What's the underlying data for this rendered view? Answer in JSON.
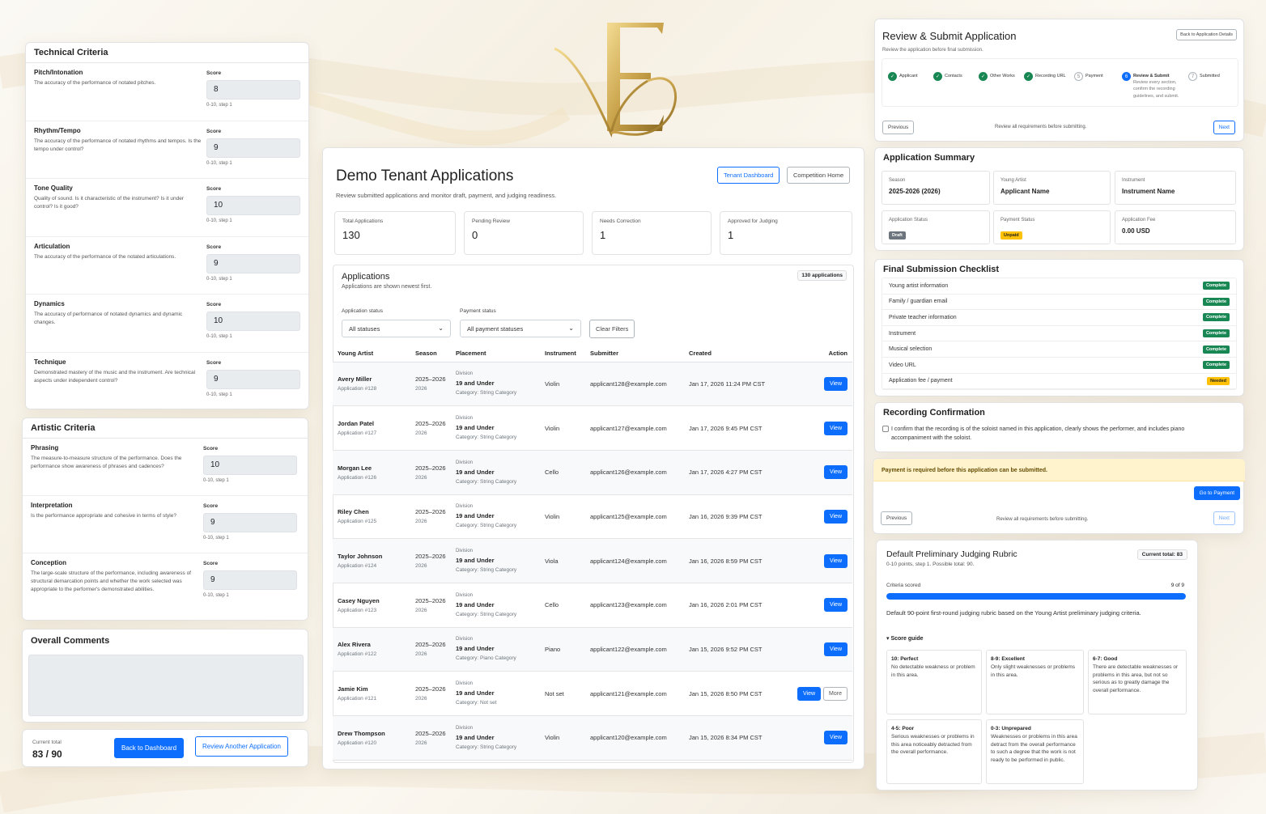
{
  "rubric": {
    "technical_title": "Technical Criteria",
    "artistic_title": "Artistic Criteria",
    "technical": [
      {
        "name": "Pitch/Intonation",
        "desc": "The accuracy of the performance of notated pitches.",
        "score_label": "Score",
        "score": "8",
        "hint": "0-10, step 1"
      },
      {
        "name": "Rhythm/Tempo",
        "desc": "The accuracy of the performance of notated rhythms and tempos. Is the tempo under control?",
        "score_label": "Score",
        "score": "9",
        "hint": "0-10, step 1"
      },
      {
        "name": "Tone Quality",
        "desc": "Quality of sound. Is it characteristic of the instrument? Is it under control? Is it good?",
        "score_label": "Score",
        "score": "10",
        "hint": "0-10, step 1"
      },
      {
        "name": "Articulation",
        "desc": "The accuracy of the performance of the notated articulations.",
        "score_label": "Score",
        "score": "9",
        "hint": "0-10, step 1"
      },
      {
        "name": "Dynamics",
        "desc": "The accuracy of performance of notated dynamics and dynamic changes.",
        "score_label": "Score",
        "score": "10",
        "hint": "0-10, step 1"
      },
      {
        "name": "Technique",
        "desc": "Demonstrated mastery of the music and the instrument. Are technical aspects under independent control?",
        "score_label": "Score",
        "score": "9",
        "hint": "0-10, step 1"
      }
    ],
    "artistic": [
      {
        "name": "Phrasing",
        "desc": "The measure-to-measure structure of the performance. Does the performance show awareness of phrases and cadences?",
        "score_label": "Score",
        "score": "10",
        "hint": "0-10, step 1"
      },
      {
        "name": "Interpretation",
        "desc": "Is the performance appropriate and cohesive in terms of style?",
        "score_label": "Score",
        "score": "9",
        "hint": "0-10, step 1"
      },
      {
        "name": "Conception",
        "desc": "The large-scale structure of the performance, including awareness of structural demarcation points and whether the work selected was appropriate to the performer's demonstrated abilities.",
        "score_label": "Score",
        "score": "9",
        "hint": "0-10, step 1"
      }
    ],
    "comments_title": "Overall Comments",
    "total_label": "Current total",
    "total_value": "83 / 90",
    "back_button": "Back to Dashboard",
    "review_another_button": "Review Another Application"
  },
  "center": {
    "title": "Demo Tenant Applications",
    "subtitle": "Review submitted applications and monitor draft, payment, and judging readiness.",
    "tenant_dashboard_button": "Tenant Dashboard",
    "competition_home_button": "Competition Home",
    "stats": [
      {
        "label": "Total Applications",
        "value": "130"
      },
      {
        "label": "Pending Review",
        "value": "0"
      },
      {
        "label": "Needs Correction",
        "value": "1"
      },
      {
        "label": "Approved for Judging",
        "value": "1"
      }
    ],
    "apps_title": "Applications",
    "apps_subtitle": "Applications are shown newest first.",
    "apps_count": "130 applications",
    "filter_status_label": "Application status",
    "filter_status_value": "All statuses",
    "filter_payment_label": "Payment status",
    "filter_payment_value": "All payment statuses",
    "clear_filters": "Clear Filters",
    "columns": [
      "Young Artist",
      "Season",
      "Placement",
      "Instrument",
      "Submitter",
      "Created",
      "Action"
    ],
    "rows": [
      {
        "name": "Avery Miller",
        "app": "Application #128",
        "season1": "2025–2026",
        "season2": "2026",
        "division_label": "Division",
        "division": "19 and Under",
        "category": "Category: String Category",
        "instrument": "Violin",
        "submitter": "applicant128@example.com",
        "created": "Jan 17, 2026 11:24 PM CST",
        "view": "View",
        "more": ""
      },
      {
        "name": "Jordan Patel",
        "app": "Application #127",
        "season1": "2025–2026",
        "season2": "2026",
        "division_label": "Division",
        "division": "19 and Under",
        "category": "Category: String Category",
        "instrument": "Violin",
        "submitter": "applicant127@example.com",
        "created": "Jan 17, 2026 9:45 PM CST",
        "view": "View",
        "more": ""
      },
      {
        "name": "Morgan Lee",
        "app": "Application #126",
        "season1": "2025–2026",
        "season2": "2026",
        "division_label": "Division",
        "division": "19 and Under",
        "category": "Category: String Category",
        "instrument": "Cello",
        "submitter": "applicant126@example.com",
        "created": "Jan 17, 2026 4:27 PM CST",
        "view": "View",
        "more": ""
      },
      {
        "name": "Riley Chen",
        "app": "Application #125",
        "season1": "2025–2026",
        "season2": "2026",
        "division_label": "Division",
        "division": "19 and Under",
        "category": "Category: String Category",
        "instrument": "Violin",
        "submitter": "applicant125@example.com",
        "created": "Jan 16, 2026 9:39 PM CST",
        "view": "View",
        "more": ""
      },
      {
        "name": "Taylor Johnson",
        "app": "Application #124",
        "season1": "2025–2026",
        "season2": "2026",
        "division_label": "Division",
        "division": "19 and Under",
        "category": "Category: String Category",
        "instrument": "Viola",
        "submitter": "applicant124@example.com",
        "created": "Jan 16, 2026 8:59 PM CST",
        "view": "View",
        "more": ""
      },
      {
        "name": "Casey Nguyen",
        "app": "Application #123",
        "season1": "2025–2026",
        "season2": "2026",
        "division_label": "Division",
        "division": "19 and Under",
        "category": "Category: String Category",
        "instrument": "Cello",
        "submitter": "applicant123@example.com",
        "created": "Jan 16, 2026 2:01 PM CST",
        "view": "View",
        "more": ""
      },
      {
        "name": "Alex Rivera",
        "app": "Application #122",
        "season1": "2025–2026",
        "season2": "2026",
        "division_label": "Division",
        "division": "19 and Under",
        "category": "Category: Piano Category",
        "instrument": "Piano",
        "submitter": "applicant122@example.com",
        "created": "Jan 15, 2026 9:52 PM CST",
        "view": "View",
        "more": ""
      },
      {
        "name": "Jamie Kim",
        "app": "Application #121",
        "season1": "2025–2026",
        "season2": "2026",
        "division_label": "Division",
        "division": "19 and Under",
        "category": "Category: Not set",
        "instrument": "Not set",
        "submitter": "applicant121@example.com",
        "created": "Jan 15, 2026 8:50 PM CST",
        "view": "View",
        "more": "More"
      },
      {
        "name": "Drew Thompson",
        "app": "Application #120",
        "season1": "2025–2026",
        "season2": "2026",
        "division_label": "Division",
        "division": "19 and Under",
        "category": "Category: String Category",
        "instrument": "Violin",
        "submitter": "applicant120@example.com",
        "created": "Jan 15, 2026 8:34 PM CST",
        "view": "View",
        "more": ""
      }
    ]
  },
  "review": {
    "title": "Review & Submit Application",
    "subtitle": "Review the application before final submission.",
    "back_button": "Back to Application Details",
    "steps": [
      {
        "label": "Applicant",
        "state": "done",
        "num": "✓"
      },
      {
        "label": "Contacts",
        "state": "done",
        "num": "✓"
      },
      {
        "label": "Other Works",
        "state": "done",
        "num": "✓"
      },
      {
        "label": "Recording URL",
        "state": "done",
        "num": "✓"
      },
      {
        "label": "Payment",
        "state": "todo",
        "num": "5"
      },
      {
        "label": "Review & Submit",
        "state": "cur",
        "num": "6"
      },
      {
        "label": "Submitted",
        "state": "todo",
        "num": "7"
      }
    ],
    "step_note": "Review every section, confirm the recording guidelines, and submit.",
    "previous": "Previous",
    "next": "Next",
    "nav_note": "Review all requirements before submitting.",
    "summary_title": "Application Summary",
    "summary": {
      "season_label": "Season",
      "season": "2025-2026 (2026)",
      "artist_label": "Young Artist",
      "artist": "Applicant Name",
      "instrument_label": "Instrument",
      "instrument": "Instrument Name",
      "status_label": "Application Status",
      "status": "Draft",
      "payment_label": "Payment Status",
      "payment": "Unpaid",
      "fee_label": "Application Fee",
      "fee": "0.00 USD"
    },
    "checklist_title": "Final Submission Checklist",
    "checklist": [
      {
        "item": "Young artist information",
        "status": "Complete"
      },
      {
        "item": "Family / guardian email",
        "status": "Complete"
      },
      {
        "item": "Private teacher information",
        "status": "Complete"
      },
      {
        "item": "Instrument",
        "status": "Complete"
      },
      {
        "item": "Musical selection",
        "status": "Complete"
      },
      {
        "item": "Video URL",
        "status": "Complete"
      },
      {
        "item": "Application fee / payment",
        "status": "Needed"
      }
    ],
    "recording_title": "Recording Confirmation",
    "recording_text": "I confirm that the recording is of the soloist named in this application, clearly shows the performer, and includes piano accompaniment with the soloist.",
    "payment_alert": "Payment is required before this application can be submitted.",
    "go_payment": "Go to Payment"
  },
  "judging": {
    "title": "Default Preliminary Judging Rubric",
    "subtitle": "0-10 points, step 1. Possible total: 90.",
    "current_total": "Current total: 83",
    "scored_label": "Criteria scored",
    "scored_value": "9 of 9",
    "scored_fraction": 1.0,
    "description": "Default 90-point first-round judging rubric based on the Young Artist preliminary judging criteria.",
    "guide_label": "▾ Score guide",
    "guide": [
      {
        "title": "10: Perfect",
        "text": "No detectable weakness or problem in this area."
      },
      {
        "title": "8-9: Excellent",
        "text": "Only slight weaknesses or problems in this area."
      },
      {
        "title": "6-7: Good",
        "text": "There are detectable weaknesses or problems in this area, but not so serious as to greatly damage the overall performance."
      },
      {
        "title": "4-5: Poor",
        "text": "Serious weaknesses or problems in this area noticeably detracted from the overall performance."
      },
      {
        "title": "0-3: Unprepared",
        "text": "Weaknesses or problems in this area detract from the overall performance to such a degree that the work is not ready to be performed in public."
      }
    ]
  },
  "colors": {
    "primary": "#0d6efd",
    "success": "#198754",
    "warning": "#ffc107",
    "gold": "#c9a24a"
  }
}
